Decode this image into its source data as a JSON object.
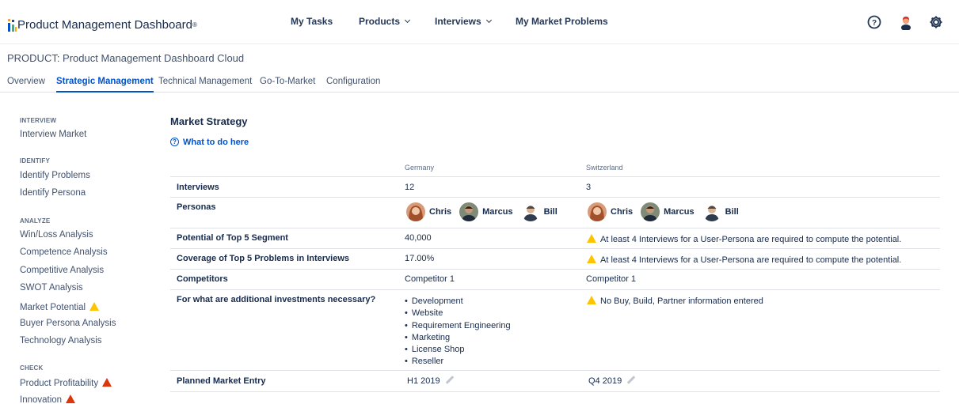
{
  "app": {
    "title": "Product Management Dashboard",
    "trademark": "®",
    "logo_colors": [
      "#ff8b00",
      "#0052cc",
      "#36b37e",
      "#ffab00"
    ]
  },
  "nav": {
    "items": [
      {
        "label": "My Tasks",
        "has_dropdown": false
      },
      {
        "label": "Products",
        "has_dropdown": true
      },
      {
        "label": "Interviews",
        "has_dropdown": true
      },
      {
        "label": "My Market Problems",
        "has_dropdown": false
      }
    ],
    "icons": [
      "help-icon",
      "user-avatar-icon",
      "settings-gear-icon"
    ]
  },
  "product": {
    "title": "PRODUCT: Product Management Dashboard Cloud"
  },
  "tabs": [
    {
      "label": "Overview",
      "active": false
    },
    {
      "label": "Strategic Management",
      "active": true
    },
    {
      "label": "Technical Management",
      "active": false
    },
    {
      "label": "Go-To-Market",
      "active": false
    },
    {
      "label": "Configuration",
      "active": false
    }
  ],
  "sidebar": {
    "sections": [
      {
        "heading": "INTERVIEW",
        "items": [
          {
            "label": "Interview Market",
            "status": null
          }
        ]
      },
      {
        "heading": "IDENTIFY",
        "items": [
          {
            "label": "Identify Problems",
            "status": null
          },
          {
            "label": "Identify Persona",
            "status": null
          }
        ]
      },
      {
        "heading": "ANALYZE",
        "items": [
          {
            "label": "Win/Loss Analysis",
            "status": null
          },
          {
            "label": "Competence Analysis",
            "status": null
          },
          {
            "label": "Competitive Analysis",
            "status": null
          },
          {
            "label": "SWOT Analysis",
            "status": null
          },
          {
            "label": "Market Potential",
            "status": "warning"
          },
          {
            "label": "Buyer Persona Analysis",
            "status": null
          },
          {
            "label": "Technology Analysis",
            "status": null
          }
        ]
      },
      {
        "heading": "CHECK",
        "items": [
          {
            "label": "Product Profitability",
            "status": "error"
          },
          {
            "label": "Innovation",
            "status": "error"
          }
        ]
      }
    ]
  },
  "main": {
    "title": "Market Strategy",
    "help_link": "What to do here",
    "columns": [
      "Germany",
      "Switzerland"
    ],
    "rows": {
      "interviews": {
        "label": "Interviews",
        "values": [
          "12",
          "3"
        ]
      },
      "personas": {
        "label": "Personas",
        "values": [
          [
            {
              "name": "Chris"
            },
            {
              "name": "Marcus"
            },
            {
              "name": "Bill"
            }
          ],
          [
            {
              "name": "Chris"
            },
            {
              "name": "Marcus"
            },
            {
              "name": "Bill"
            }
          ]
        ]
      },
      "potential": {
        "label": "Potential of Top 5 Segment",
        "values": [
          "40,000",
          "At least 4 Interviews for a User-Persona are required to compute the potential."
        ]
      },
      "coverage": {
        "label": "Coverage of Top 5 Problems in Interviews",
        "values": [
          "17.00%",
          "At least 4 Interviews for a User-Persona are required to compute the potential."
        ]
      },
      "competitors": {
        "label": "Competitors",
        "values": [
          "Competitor 1",
          "Competitor 1"
        ]
      },
      "investments": {
        "label": "For what are additional investments necessary?",
        "germany": [
          "Development",
          "Website",
          "Requirement Engineering",
          "Marketing",
          "License Shop",
          "Reseller"
        ],
        "switzerland": "No Buy, Build, Partner information entered"
      },
      "entry": {
        "label": "Planned Market Entry",
        "values": [
          "H1 2019",
          "Q4 2019"
        ]
      }
    }
  },
  "colors": {
    "accent": "#0052cc",
    "warning": "#ffc400",
    "error": "#de350b"
  }
}
